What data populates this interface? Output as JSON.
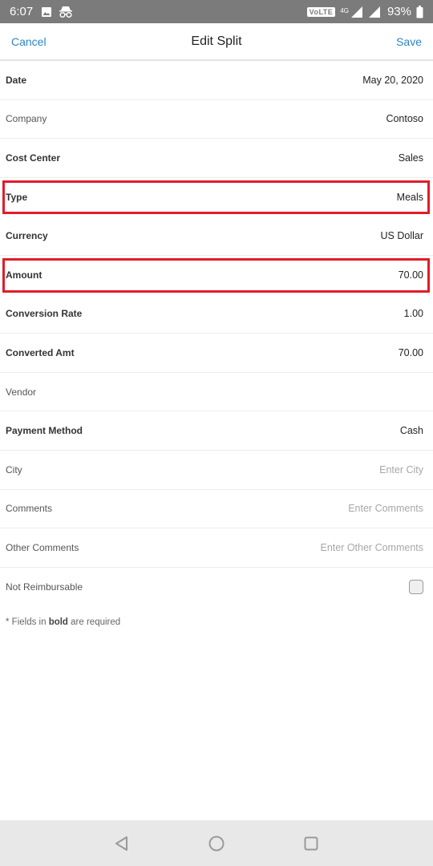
{
  "status_bar": {
    "time": "6:07",
    "volte": "VoLTE",
    "network": "4G",
    "battery": "93%"
  },
  "header": {
    "cancel_label": "Cancel",
    "title": "Edit Split",
    "save_label": "Save"
  },
  "fields": {
    "date": {
      "label": "Date",
      "value": "May 20, 2020"
    },
    "company": {
      "label": "Company",
      "value": "Contoso"
    },
    "cost_center": {
      "label": "Cost Center",
      "value": "Sales"
    },
    "type": {
      "label": "Type",
      "value": "Meals"
    },
    "currency": {
      "label": "Currency",
      "value": "US Dollar"
    },
    "amount": {
      "label": "Amount",
      "value": "70.00"
    },
    "conversion_rate": {
      "label": "Conversion Rate",
      "value": "1.00"
    },
    "converted_amt": {
      "label": "Converted Amt",
      "value": "70.00"
    },
    "vendor": {
      "label": "Vendor",
      "value": ""
    },
    "payment_method": {
      "label": "Payment Method",
      "value": "Cash"
    },
    "city": {
      "label": "City",
      "placeholder": "Enter City"
    },
    "comments": {
      "label": "Comments",
      "placeholder": "Enter Comments"
    },
    "other_comments": {
      "label": "Other Comments",
      "placeholder": "Enter Other Comments"
    },
    "not_reimbursable": {
      "label": "Not Reimbursable",
      "checked": false
    }
  },
  "footnote": {
    "prefix": "* Fields in ",
    "bold": "bold",
    "suffix": " are required"
  },
  "highlight_color": "#e21c2a",
  "accent_color": "#2a86c4"
}
